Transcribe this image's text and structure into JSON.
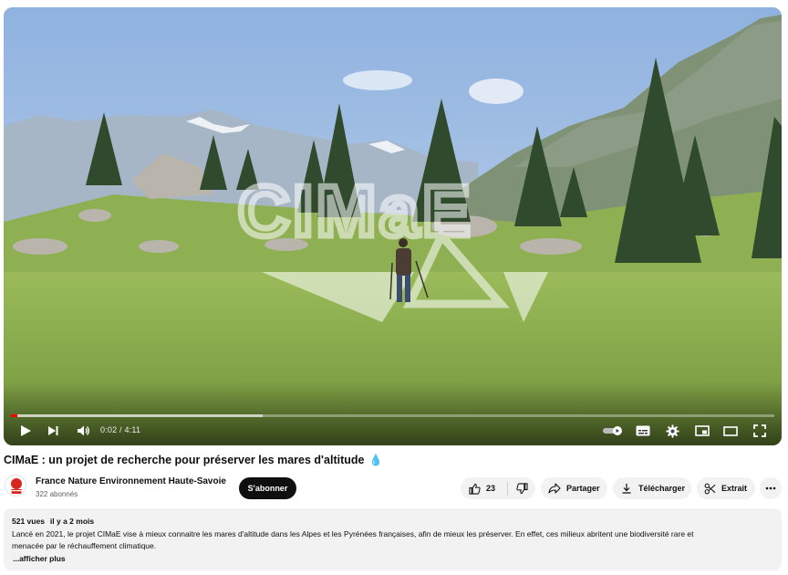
{
  "player": {
    "time_current": "0:02",
    "time_separator": " / ",
    "time_total": "4:11",
    "progress_fraction": 0.008,
    "buffered_fraction": 0.33,
    "watermark_text": "CIMaE",
    "icons": [
      "play-icon",
      "next-icon",
      "volume-icon",
      "autoplay-toggle-icon",
      "subtitles-icon",
      "settings-icon",
      "miniplayer-icon",
      "theater-icon",
      "fullscreen-icon"
    ],
    "accent_color": "#ff0000"
  },
  "video": {
    "title": "CIMaE : un projet de recherche pour préserver les mares d'altitude",
    "title_emoji": "💧"
  },
  "channel": {
    "name": "France Nature Environnement Haute-Savoie",
    "subscribers": "322 abonnés",
    "subscribe_label": "S'abonner"
  },
  "actions": {
    "like_count": "23",
    "share_label": "Partager",
    "download_label": "Télécharger",
    "clip_label": "Extrait",
    "more_icon": "more-horizontal-icon"
  },
  "description": {
    "views": "521 vues",
    "date": "il y a 2 mois",
    "text_line1": "Lancé en 2021, le projet CIMaE vise à mieux connaitre les mares d'altitude dans les Alpes et les Pyrénées françaises, afin de mieux les préserver. En effet, ces milieux abritent une biodiversité rare et",
    "text_line2": "menacée par le réchauffement climatique.",
    "show_more": "...afficher plus"
  }
}
